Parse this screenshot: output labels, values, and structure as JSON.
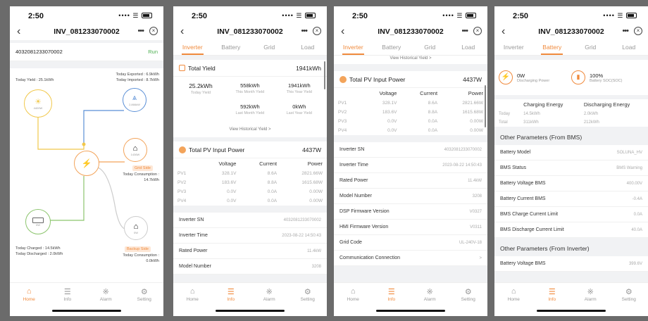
{
  "status": {
    "time": "2:50",
    "signal": "•••• ☰"
  },
  "device_title": "INV_081233070002",
  "tabs": [
    "Inverter",
    "Battery",
    "Grid",
    "Load"
  ],
  "nav": [
    {
      "label": "Home",
      "icon": "home-icon",
      "glyph": "⌂"
    },
    {
      "label": "Info",
      "icon": "info-icon",
      "glyph": "☰"
    },
    {
      "label": "Alarm",
      "icon": "alarm-icon",
      "glyph": "※"
    },
    {
      "label": "Setting",
      "icon": "gear-icon",
      "glyph": "⚙"
    }
  ],
  "accent": "#f08a3c",
  "home": {
    "serial": "4032081233070002",
    "state": "Run",
    "today_yield": "Today Yield : 25.1kWh",
    "today_exported": "Today Exported : 6.9kWh",
    "today_imported": "Today Imported : 8.7kWh",
    "pv_power": "4400W",
    "grid_power": "2,866kW",
    "load_power": "1436W",
    "battery_power": "0W",
    "backup_power": "0W",
    "grid_side": "Grid Side",
    "grid_consumption": "Today Consumption :",
    "grid_consumption_value": "14.7kWh",
    "today_charged": "Today Charged : 14.5kWh",
    "today_discharged": "Today Discharged : 2.0kWh",
    "backup_side": "Backup Side",
    "backup_consumption": "Today Consumption :",
    "backup_consumption_value": "0.0kWh"
  },
  "yield": {
    "title": "Total Yield",
    "total": "1941kWh",
    "items": [
      {
        "value": "25.2kWh",
        "label": "Today Yield"
      },
      {
        "value": "558kWh",
        "label": "This Month Yield"
      },
      {
        "value": "1941kWh",
        "label": "This Year Yield"
      },
      {
        "value": "592kWh",
        "label": "Last Month Yield"
      },
      {
        "value": "0kWh",
        "label": "Last Year Yield"
      }
    ],
    "history_link": "View Historical Yield >"
  },
  "pv": {
    "title": "Total PV Input Power",
    "total": "4437W",
    "headers": [
      "",
      "Voltage",
      "Current",
      "Power"
    ],
    "rows": [
      [
        "PV1",
        "328.1V",
        "8.6A",
        "2821.66W"
      ],
      [
        "PV2",
        "183.6V",
        "8.8A",
        "1615.68W"
      ],
      [
        "PV3",
        "0.0V",
        "0.0A",
        "0.00W"
      ],
      [
        "PV4",
        "0.0V",
        "0.0A",
        "0.00W"
      ]
    ]
  },
  "inverter_info": [
    {
      "label": "Inverter SN",
      "value": "4032081233070002"
    },
    {
      "label": "Inverter Time",
      "value": "2023-08-22 14:50:43"
    },
    {
      "label": "Rated Power",
      "value": "11.4kW"
    },
    {
      "label": "Model Number",
      "value": "3208"
    },
    {
      "label": "DSP Firmware Version",
      "value": "V0327"
    },
    {
      "label": "HMI Firmware Version",
      "value": "V0311"
    },
    {
      "label": "Grid Code",
      "value": "UL-240V-18"
    },
    {
      "label": "Communication Connection",
      "value": ">"
    }
  ],
  "battery": {
    "power_value": "0W",
    "power_label": "Discharging Power",
    "soc_value": "100%",
    "soc_label": "Battery SOC(SOC)",
    "headers": [
      "",
      "Charging Energy",
      "Discharging Energy"
    ],
    "rows": [
      [
        "Today",
        "14.5kWh",
        "2.0kWh"
      ],
      [
        "Total",
        "311kWh",
        "212kWh"
      ]
    ],
    "bms_title": "Other Parameters (From BMS)",
    "bms": [
      {
        "label": "Battery Model",
        "value": "SOLUNA_HV"
      },
      {
        "label": "BMS Status",
        "value": "BMS Warning"
      },
      {
        "label": "Battery Voltage BMS",
        "value": "400.00V"
      },
      {
        "label": "Battery Current BMS",
        "value": "-0.4A"
      },
      {
        "label": "BMS Charge Current Limit",
        "value": "0.0A"
      },
      {
        "label": "BMS Discharge Current Limit",
        "value": "40.0A"
      }
    ],
    "inv_title": "Other Parameters (From Inverter)",
    "inv": [
      {
        "label": "Battery Voltage BMS",
        "value": "399.6V"
      }
    ]
  }
}
